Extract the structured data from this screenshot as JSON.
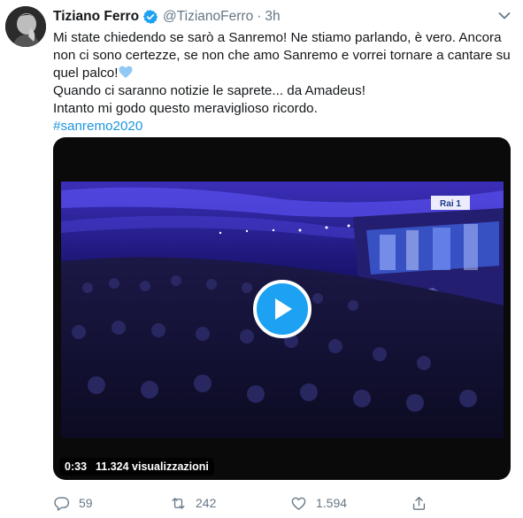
{
  "tweet": {
    "author_name": "Tiziano Ferro",
    "verified_icon": "verified-badge-icon",
    "handle": "@TizianoFerro",
    "separator": "·",
    "time": "3h",
    "text_lines": [
      "Mi state chiedendo se sarò a Sanremo! Ne stiamo parlando, è vero. Ancora",
      "non ci sono certezze, se non che amo Sanremo e vorrei tornare a cantare su",
      "quel palco!",
      "Quando ci saranno notizie le saprete... da Amadeus!",
      "Intanto mi godo questo meraviglioso ricordo."
    ],
    "hashtag": "#sanremo2020",
    "media": {
      "duration": "0:33",
      "views": "11.324 visualizzazioni",
      "channel_logo": "Rai 1"
    },
    "actions": {
      "reply_count": "59",
      "retweet_count": "242",
      "like_count": "1.594"
    }
  },
  "colors": {
    "accent": "#1da1f2",
    "hashtag": "#1b95e0",
    "muted": "#657786",
    "heart": "#91c8f5"
  }
}
